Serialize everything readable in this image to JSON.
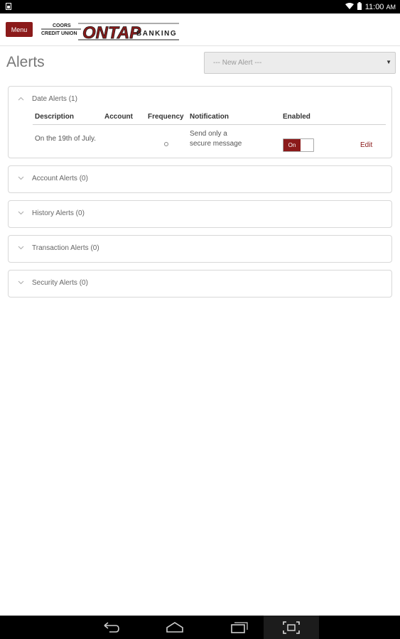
{
  "status_bar": {
    "time": "11:00",
    "time_suffix": "AM"
  },
  "header": {
    "menu_label": "Menu",
    "logo_line1": "COORS",
    "logo_line2": "CREDIT UNION",
    "logo_main": "ONTAP",
    "logo_banking": "BANKING",
    "brand_color": "#8b1a1a"
  },
  "page": {
    "title": "Alerts",
    "new_alert_select": {
      "selected": "--- New Alert ---"
    }
  },
  "panels": [
    {
      "title": "Date Alerts (1)",
      "expanded": true,
      "columns": [
        "Description",
        "Account",
        "Frequency",
        "Notification",
        "Enabled"
      ],
      "rows": [
        {
          "description": "On the 19th of July.",
          "account": "",
          "notification_line1": "Send only a",
          "notification_line2": "secure message",
          "enabled": "On",
          "action": "Edit"
        }
      ]
    },
    {
      "title": "Account Alerts (0)",
      "expanded": false
    },
    {
      "title": "History Alerts (0)",
      "expanded": false
    },
    {
      "title": "Transaction Alerts (0)",
      "expanded": false
    },
    {
      "title": "Security Alerts (0)",
      "expanded": false
    }
  ],
  "icons": {
    "status_left": "sim-card-icon",
    "wifi": "wifi-icon",
    "battery": "battery-icon",
    "back": "back-icon",
    "home": "home-icon",
    "recents": "recents-icon",
    "screenshot": "screenshot-icon",
    "chevron": "chevron-down-icon"
  }
}
